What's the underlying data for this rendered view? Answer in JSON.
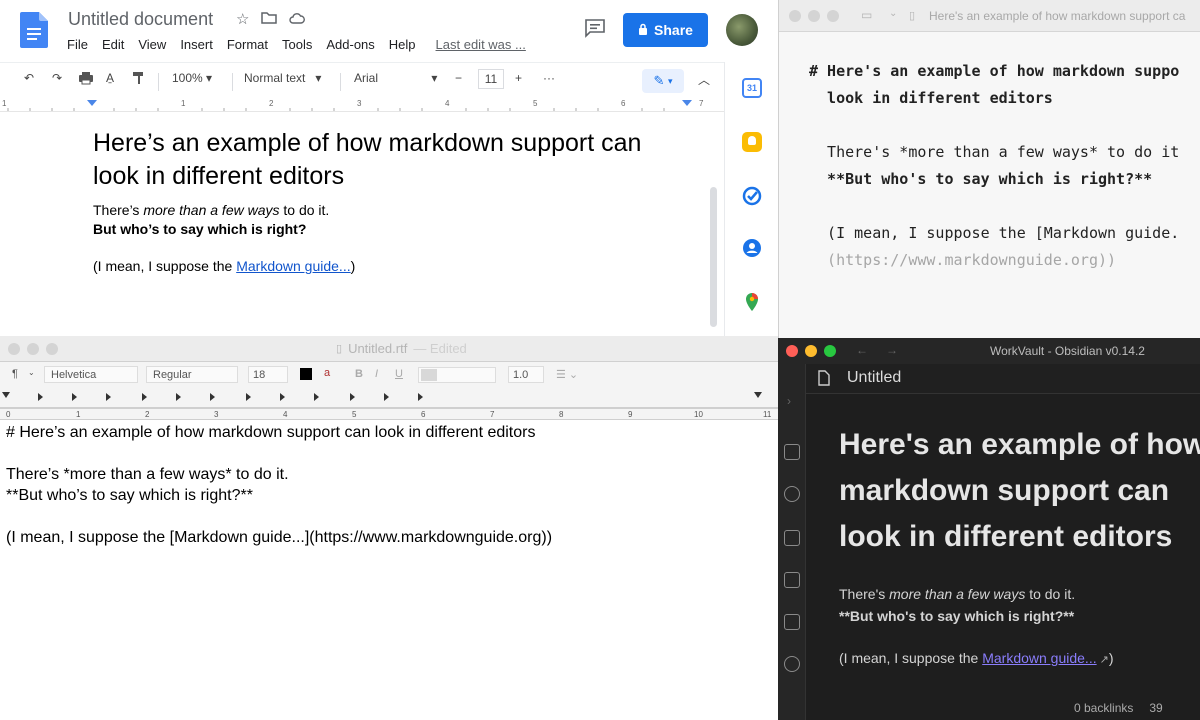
{
  "gdocs": {
    "title": "Untitled document",
    "menu": [
      "File",
      "Edit",
      "View",
      "Insert",
      "Format",
      "Tools",
      "Add-ons",
      "Help"
    ],
    "last_edit": "Last edit was ...",
    "share_label": "Share",
    "toolbar": {
      "zoom": "100%",
      "style": "Normal text",
      "font": "Arial",
      "font_size": "11",
      "minus": "−",
      "plus": "+",
      "more": "···"
    },
    "ruler_ticks": [
      "1",
      "1",
      "2",
      "3",
      "4",
      "5",
      "6",
      "7"
    ],
    "content": {
      "heading": "Here’s an example of how markdown support can look in different editors",
      "p1_a": "There’s ",
      "p1_em": "more than a few ways",
      "p1_b": " to do it.",
      "p2": "But who’s to say which is right?",
      "p3_a": "(I mean, I suppose the ",
      "p3_link": "Markdown guide...",
      "p3_b": ")"
    }
  },
  "textedit": {
    "title": "Untitled.rtf",
    "edited": "— Edited",
    "toolbar": {
      "paragraph": "¶",
      "font": "Helvetica",
      "weight": "Regular",
      "size": "18",
      "bold": "B",
      "italic": "I",
      "underline": "U",
      "spacing": "1.0"
    },
    "ruler_numbers": [
      "0",
      "1",
      "2",
      "3",
      "4",
      "5",
      "6",
      "7",
      "8",
      "9",
      "10",
      "11"
    ],
    "lines": [
      "# Here’s an example of how markdown support can look in different editors",
      "",
      "There’s *more than a few ways* to do it.",
      "**But who’s to say which is right?**",
      "",
      "(I mean, I suppose the [Markdown guide...](https://www.markdownguide.org))"
    ]
  },
  "md_editor": {
    "title": "Here's an example of how markdown support ca",
    "line1": "# Here's an example of how markdown suppo",
    "line2": "  look in different editors",
    "line3": "  There's *more than a few ways* to do it",
    "line4": "  **But who's to say which is right?**",
    "line5": "  (I mean, I suppose the [Markdown guide.",
    "line6": "  (https://www.markdownguide.org))"
  },
  "obsidian": {
    "title": "WorkVault - Obsidian v0.14.2",
    "tab": "Untitled",
    "heading": "Here's an example of how markdown support can look in different editors",
    "p1_a": "There's ",
    "p1_em": "more than a few ways",
    "p1_b": " to do it.",
    "p2": "**But who's to say which is right?**",
    "p3_a": "(I mean, I suppose the ",
    "p3_link": "Markdown guide...",
    "p3_b": ")",
    "backlinks": "0 backlinks",
    "words": "39"
  }
}
